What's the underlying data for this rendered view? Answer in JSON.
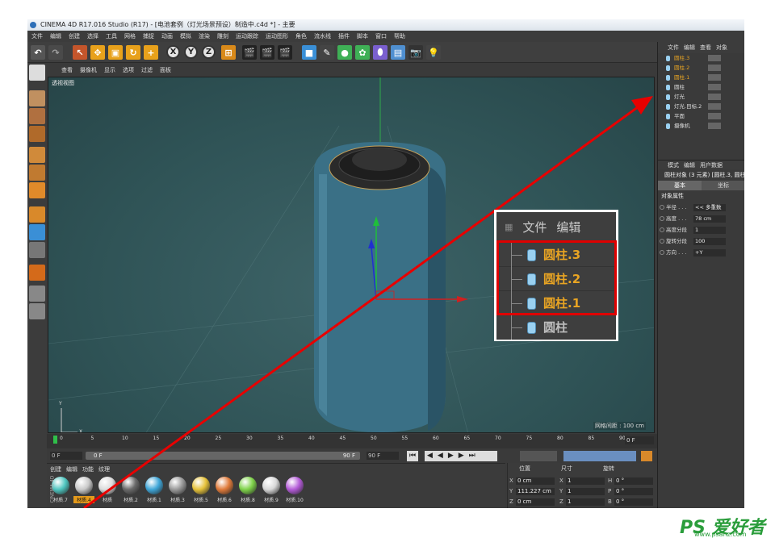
{
  "window": {
    "title": "CINEMA 4D R17.016 Studio (R17) - [电池套例（灯光场景预设）制造中.c4d *] - 主要"
  },
  "menubar": [
    "文件",
    "编辑",
    "创建",
    "选择",
    "工具",
    "网格",
    "捕捉",
    "动画",
    "模拟",
    "渲染",
    "雕刻",
    "运动跟踪",
    "运动图形",
    "角色",
    "流水线",
    "插件",
    "脚本",
    "窗口",
    "帮助"
  ],
  "toolbar": {
    "x": "X",
    "y": "Y",
    "z": "Z"
  },
  "viewport_menu": [
    "查看",
    "摄像机",
    "显示",
    "选项",
    "过滤",
    "面板"
  ],
  "viewport": {
    "title": "透视视图",
    "grid_spacing": "网格间距 : 100 cm",
    "axis_y": "Y",
    "axis_x": "X"
  },
  "timeline": {
    "ticks": [
      "0",
      "5",
      "10",
      "15",
      "20",
      "25",
      "30",
      "35",
      "40",
      "45",
      "50",
      "55",
      "60",
      "65",
      "70",
      "75",
      "80",
      "85",
      "90"
    ],
    "end_frame": "0 F"
  },
  "transport": {
    "start": "0 F",
    "current": "0 F",
    "end_a": "90 F",
    "end_b": "90 F"
  },
  "materials": {
    "menu": [
      "创建",
      "编辑",
      "功能",
      "纹理"
    ],
    "items": [
      {
        "label": "材质.7",
        "color": "#4ec6c0"
      },
      {
        "label": "材质.4",
        "color": "#c9c9c9",
        "selected": true
      },
      {
        "label": "材质",
        "color": "#dcdcdc"
      },
      {
        "label": "材质.2",
        "color": "#6a6a6a"
      },
      {
        "label": "材质.1",
        "color": "#3fa6d8"
      },
      {
        "label": "材质.3",
        "color": "#9a9a9a"
      },
      {
        "label": "材质.5",
        "color": "#e6c23a"
      },
      {
        "label": "材质.6",
        "color": "#e07a3a"
      },
      {
        "label": "材质.8",
        "color": "#7fd34a"
      },
      {
        "label": "材质.9",
        "color": "#d8d8d8"
      },
      {
        "label": "材质.10",
        "color": "#b45bd8"
      }
    ],
    "side_label": "CINEMA 4D"
  },
  "coords": {
    "headers": [
      "位置",
      "尺寸",
      "旋转"
    ],
    "rows": [
      {
        "a": "X",
        "av": "0 cm",
        "b": "X",
        "bv": "1",
        "c": "H",
        "cv": "0 °"
      },
      {
        "a": "Y",
        "av": "111.227 cm",
        "b": "Y",
        "bv": "1",
        "c": "P",
        "cv": "0 °"
      },
      {
        "a": "Z",
        "av": "0 cm",
        "b": "Z",
        "bv": "1",
        "c": "B",
        "cv": "0 °"
      }
    ]
  },
  "objects": {
    "menu": [
      "文件",
      "编辑",
      "查看",
      "对象"
    ],
    "items": [
      {
        "label": "圆柱.3",
        "hl": true
      },
      {
        "label": "圆柱.2",
        "hl": true
      },
      {
        "label": "圆柱.1",
        "hl": true
      },
      {
        "label": "圆柱",
        "hl": false
      },
      {
        "label": "灯光",
        "hl": false
      },
      {
        "label": "灯光.目标.2",
        "hl": false
      },
      {
        "label": "平面",
        "hl": false
      },
      {
        "label": "摄像机",
        "hl": false
      }
    ]
  },
  "attributes": {
    "menu": [
      "模式",
      "编辑",
      "用户数据"
    ],
    "header": "圆柱对象 (3 元素) [圆柱.3, 圆柱",
    "tabs": [
      "基本",
      "坐标"
    ],
    "section": "对象属性",
    "rows": [
      {
        "label": "半径 . . .",
        "value": "<< 多重数"
      },
      {
        "label": "高度 . . .",
        "value": "78 cm"
      },
      {
        "label": "高度分段",
        "value": "1"
      },
      {
        "label": "旋转分段",
        "value": "100"
      },
      {
        "label": "方向 . . .",
        "value": "+Y"
      }
    ]
  },
  "zoom": {
    "menu_file": "文件",
    "menu_edit": "编辑",
    "rows": [
      {
        "label": "圆柱.3",
        "color": "#e8a423"
      },
      {
        "label": "圆柱.2",
        "color": "#e8a423"
      },
      {
        "label": "圆柱.1",
        "color": "#e8a423"
      },
      {
        "label": "圆柱",
        "color": "#bdbdbd"
      }
    ]
  },
  "watermark": {
    "brand": "PS 爱好者",
    "url": "www.psahz.com"
  }
}
